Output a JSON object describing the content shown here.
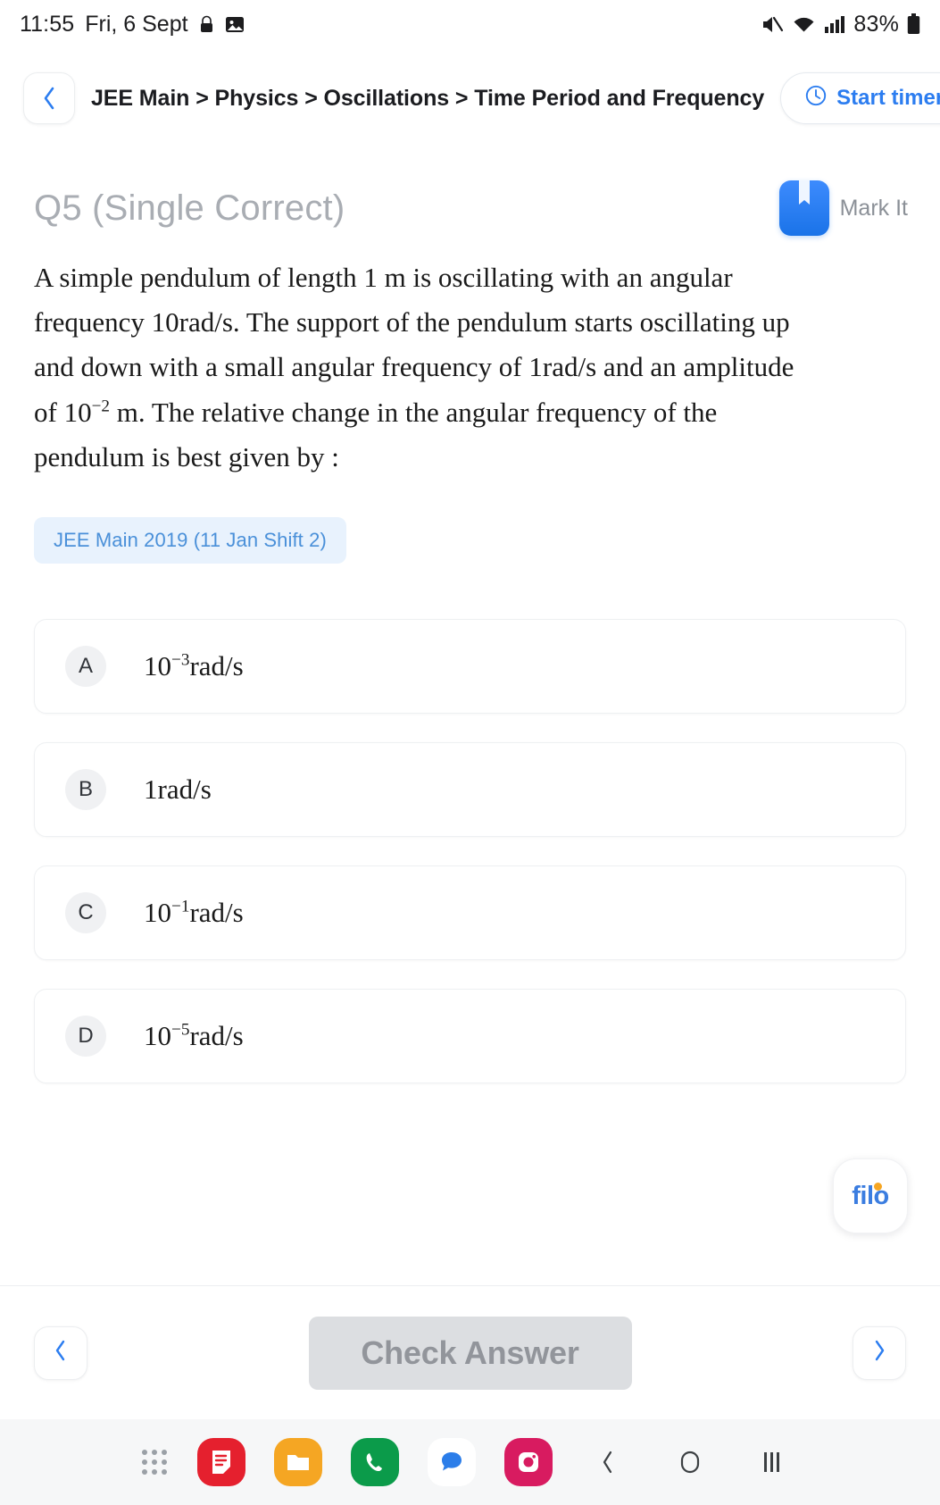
{
  "status_bar": {
    "time": "11:55",
    "date": "Fri, 6 Sept",
    "lock_icon": "lock-icon",
    "image_icon": "image-icon",
    "mute_icon": "mute-icon",
    "wifi_icon": "wifi-icon",
    "signal_icon": "signal-icon",
    "battery": "83%"
  },
  "header": {
    "back_icon": "chevron-left-icon",
    "breadcrumb": "JEE Main > Physics > Oscillations > Time Period and Frequency",
    "timer_label": "Start timer",
    "timer_icon": "clock-icon",
    "accent": "#2c7df0"
  },
  "question": {
    "title": "Q5 (Single Correct)",
    "mark_it_label": "Mark It",
    "bookmark_icon": "bookmark-icon",
    "text_parts": [
      "A simple pendulum of length 1 m is oscillating with an angular frequency 10rad/s. The support of the pendulum starts oscillating up and down with a small angular frequency of 1rad/s and an amplitude of 10",
      "−2",
      " m. The relative change in the angular frequency of the pendulum is best given by :"
    ],
    "tag": "JEE Main 2019 (11 Jan Shift 2)",
    "tag_color": "#4a90d9",
    "tag_bg": "#e8f2fd"
  },
  "options": [
    {
      "badge": "A",
      "base": "10",
      "exp": "−3",
      "unit": "rad/s"
    },
    {
      "badge": "B",
      "base": "1",
      "exp": "",
      "unit": "rad/s"
    },
    {
      "badge": "C",
      "base": "10",
      "exp": "−1",
      "unit": "rad/s"
    },
    {
      "badge": "D",
      "base": "10",
      "exp": "−5",
      "unit": "rad/s"
    }
  ],
  "watermark": {
    "logo_text": "filo",
    "logo_color": "#3b7de0",
    "dot_color": "#f6a623"
  },
  "action_bar": {
    "prev_icon": "chevron-left-icon",
    "next_icon": "chevron-right-icon",
    "check_label": "Check Answer"
  },
  "dock": {
    "app_drawer_icon": "app-grid-icon",
    "apps": [
      {
        "name": "notes-app-icon",
        "color": "#e5202e"
      },
      {
        "name": "files-app-icon",
        "color": "#f5a623"
      },
      {
        "name": "phone-app-icon",
        "color": "#0b9b4a"
      },
      {
        "name": "messages-app-icon",
        "color": "#ffffff"
      },
      {
        "name": "instagram-app-icon",
        "color": "#d81b60"
      }
    ],
    "back_icon": "nav-back-icon",
    "home_icon": "nav-home-icon",
    "recents_icon": "nav-recents-icon"
  }
}
